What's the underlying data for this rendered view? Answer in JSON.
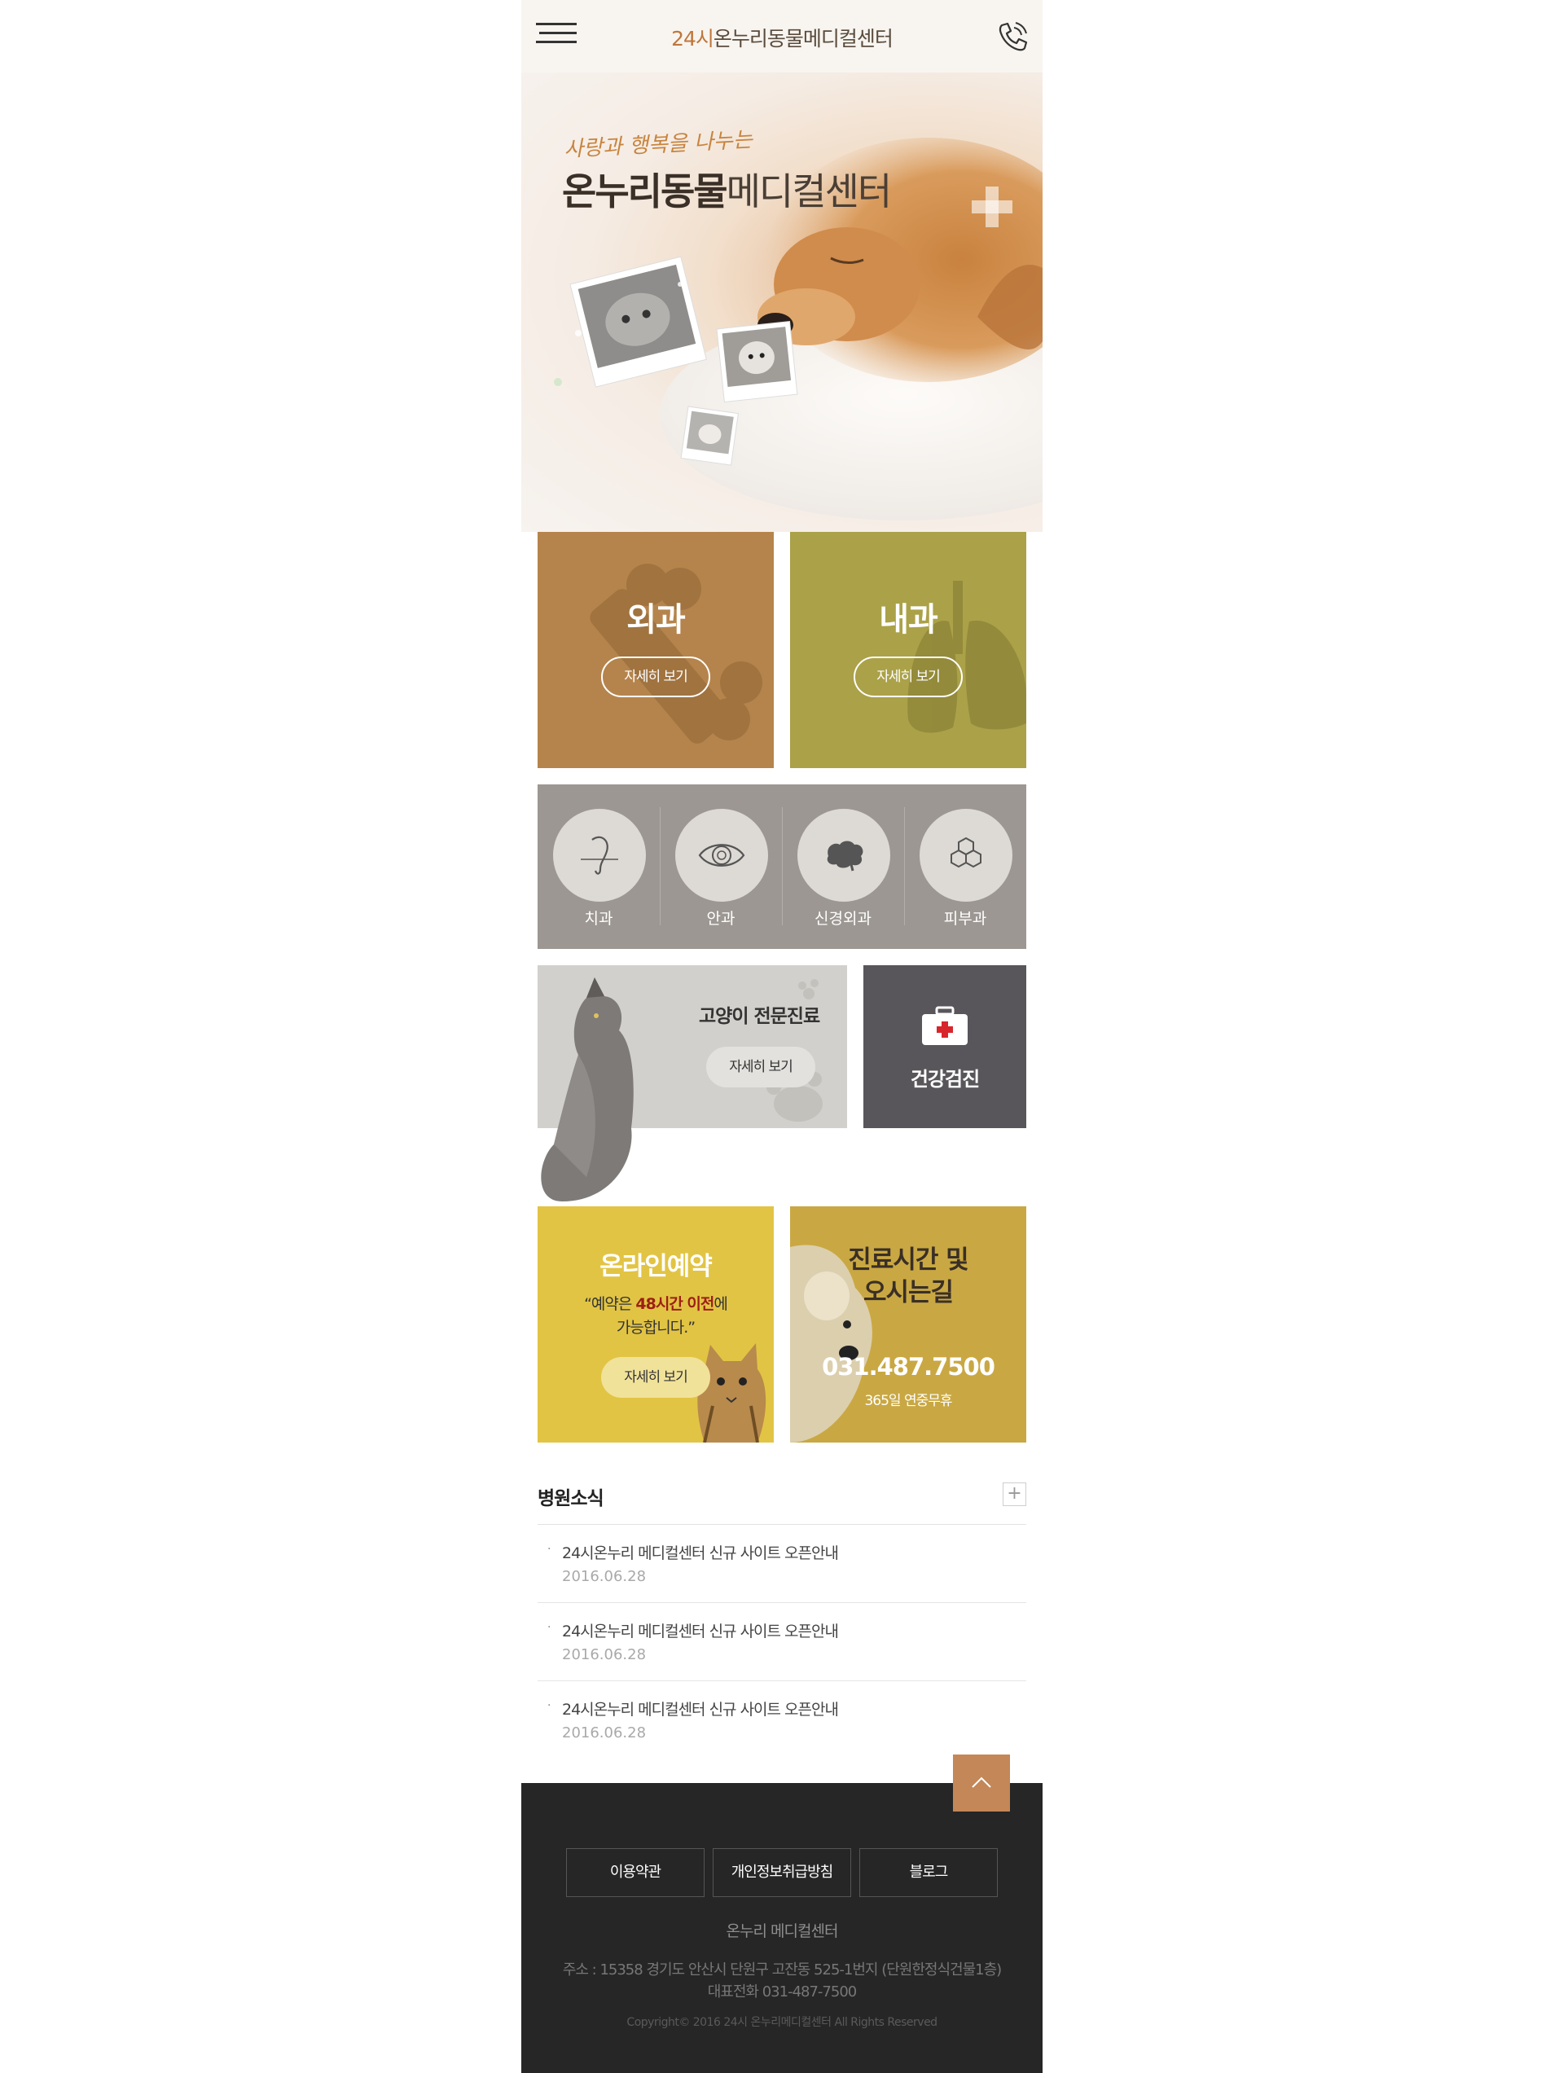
{
  "header": {
    "title_accent": "24시",
    "title_rest": "온누리동물메디컬센터"
  },
  "hero": {
    "script": "사랑과 행복을 나누는",
    "title_bold": "온누리동물",
    "title_light": "메디컬센터"
  },
  "departments": {
    "surgery": {
      "title": "외과",
      "button": "자세히 보기",
      "color": "#b5844c"
    },
    "internal": {
      "title": "내과",
      "button": "자세히 보기",
      "color": "#aba148"
    }
  },
  "specialties": [
    {
      "label": "치과",
      "icon": "tooth-icon"
    },
    {
      "label": "안과",
      "icon": "eye-icon"
    },
    {
      "label": "신경외과",
      "icon": "brain-icon"
    },
    {
      "label": "피부과",
      "icon": "hexagon-skin-icon"
    }
  ],
  "cat_care": {
    "title": "고양이 전문진료",
    "button": "자세히 보기"
  },
  "checkup": {
    "title": "건강검진",
    "icon": "first-aid-kit-icon"
  },
  "reservation": {
    "title": "온라인예약",
    "text_before": "“예약은 ",
    "text_highlight": "48시간 이전",
    "text_after": "에",
    "text_line2": "가능합니다.”",
    "button": "자세히 보기"
  },
  "hours": {
    "title_line1": "진료시간 및",
    "title_line2": "오시는길",
    "phone": "031.487.7500",
    "note": "365일 연중무휴"
  },
  "news": {
    "title": "병원소식",
    "more": "+",
    "items": [
      {
        "title": "24시온누리 메디컬센터 신규 사이트 오픈안내",
        "date": "2016.06.28"
      },
      {
        "title": "24시온누리 메디컬센터 신규 사이트 오픈안내",
        "date": "2016.06.28"
      },
      {
        "title": "24시온누리 메디컬센터 신규 사이트 오픈안내",
        "date": "2016.06.28"
      }
    ]
  },
  "footer": {
    "links": [
      "이용약관",
      "개인정보취급방침",
      "블로그"
    ],
    "name": "온누리 메디컬센터",
    "address": "주소 : 15358 경기도 안산시 단원구 고잔동 525-1번지 (단원한정식건물1층)",
    "phone": "대표전화 031-487-7500",
    "copyright": "Copyright© 2016 24시 온누리메디컬센터 All Rights Reserved"
  },
  "colors": {
    "accent": "#c0763b",
    "top_button": "#c48757",
    "footer_bg": "#262626"
  }
}
